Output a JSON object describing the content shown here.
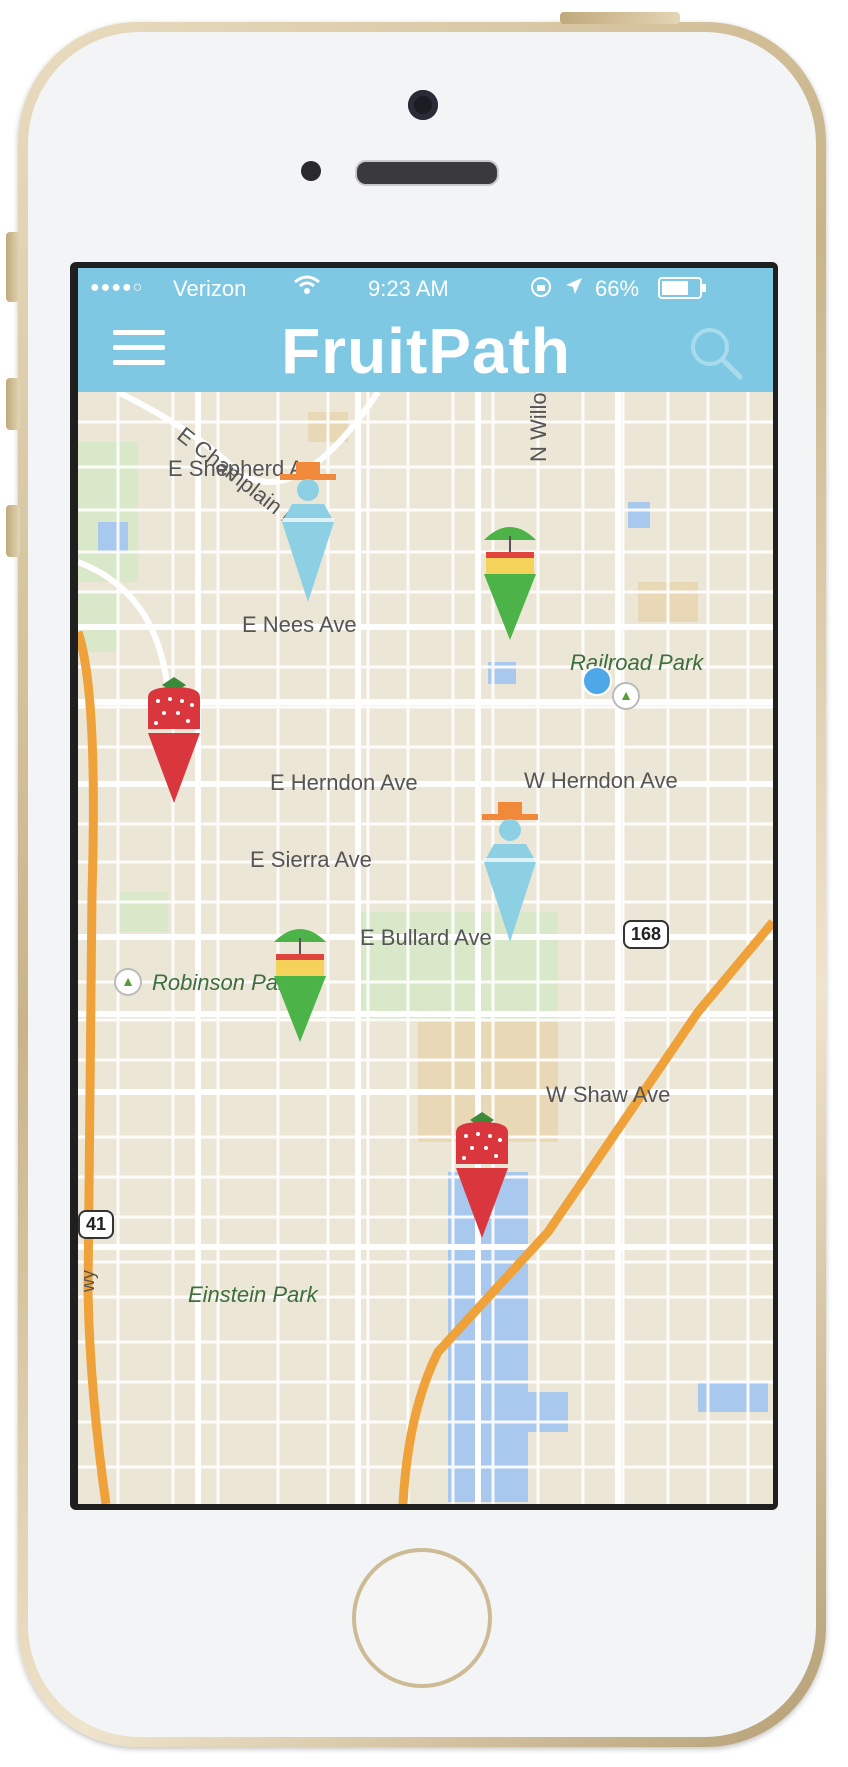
{
  "status_bar": {
    "signal": "●●●●○",
    "carrier": "Verizon",
    "time": "9:23 AM",
    "battery": "66%"
  },
  "header": {
    "app_title": "FruitPath",
    "menu_icon": "hamburger-menu-icon",
    "search_icon": "search-icon"
  },
  "map": {
    "streets": [
      "E Champlain Dr",
      "E Shepherd A",
      "N Willow Ave",
      "E Nees Ave",
      "E Herndon Ave",
      "W Herndon Ave",
      "E Sierra Ave",
      "E Bullard Ave",
      "W Shaw Ave"
    ],
    "parks": [
      "Railroad Park",
      "Robinson Park",
      "Einstein Park"
    ],
    "highways": [
      "168",
      "41"
    ],
    "freeway_fragment": "wy",
    "pins": [
      {
        "type": "farmer"
      },
      {
        "type": "stand"
      },
      {
        "type": "strawberry"
      },
      {
        "type": "farmer"
      },
      {
        "type": "stand"
      },
      {
        "type": "strawberry"
      }
    ],
    "colors": {
      "header": "#7ec8e3",
      "strawberry": "#d9363e",
      "stand": "#4cb348",
      "farmer": "#8dd0e4",
      "hat": "#f08a3a",
      "highway": "#f0a23a"
    }
  }
}
